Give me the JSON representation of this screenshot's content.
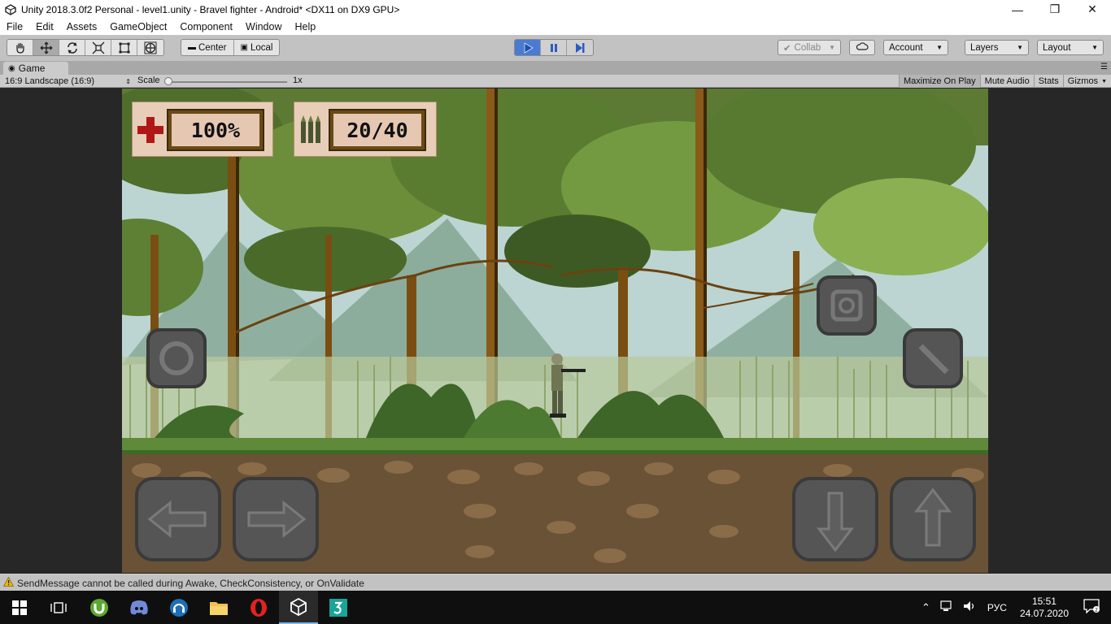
{
  "window": {
    "title": "Unity 2018.3.0f2 Personal - level1.unity - Bravel fighter - Android* <DX11 on DX9 GPU>"
  },
  "menu": [
    "File",
    "Edit",
    "Assets",
    "GameObject",
    "Component",
    "Window",
    "Help"
  ],
  "toolbar": {
    "tools": [
      "hand-icon",
      "move-icon",
      "rotate-icon",
      "scale-icon",
      "rect-icon",
      "transform-icon"
    ],
    "pivot_label": "Center",
    "space_label": "Local",
    "collab_label": "Collab",
    "account_label": "Account",
    "layers_label": "Layers",
    "layout_label": "Layout"
  },
  "game_view": {
    "tab_label": "Game",
    "aspect": "16:9 Landscape (16:9)",
    "scale_label": "Scale",
    "scale_value": "1x",
    "scale_level": 0.0,
    "maximize_label": "Maximize On Play",
    "mute_label": "Mute Audio",
    "stats_label": "Stats",
    "gizmos_label": "Gizmos"
  },
  "hud": {
    "health": "100%",
    "ammo": "20/40"
  },
  "status": {
    "message": "SendMessage cannot be called during Awake, CheckConsistency, or OnValidate"
  },
  "tray": {
    "language": "РУС",
    "time": "15:51",
    "date": "24.07.2020"
  },
  "colors": {
    "play_active": "#4a7bd1",
    "taskbar": "#0f0f0f",
    "hud_frame": "#6a4a14"
  }
}
